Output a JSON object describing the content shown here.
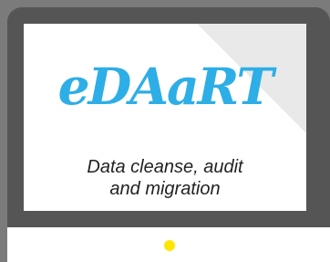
{
  "screen": {
    "logo_text": "eDAaRT",
    "tagline_line1": "Data cleanse, audit",
    "tagline_line2": "and migration"
  },
  "colors": {
    "background": "#7b7b7b",
    "bezel": "#555555",
    "screen": "#e9e9e9",
    "logo": "#2eaee6",
    "power_light": "#ffe600"
  }
}
